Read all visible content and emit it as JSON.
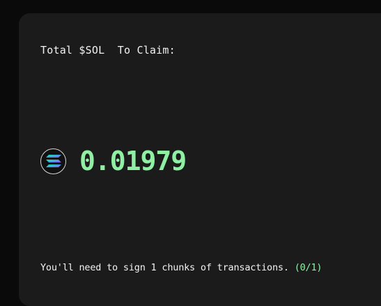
{
  "claim": {
    "title": "Total $SOL  To Claim:",
    "token_icon": "solana-logo-icon",
    "amount": "0.01979",
    "note": "You'll need to sign 1 chunks of transactions.",
    "progress": "(0/1)"
  },
  "colors": {
    "background": "#0a0a0a",
    "card": "#1b1b1b",
    "accent_green": "#8ff0a4",
    "text": "#f2f2f2"
  }
}
